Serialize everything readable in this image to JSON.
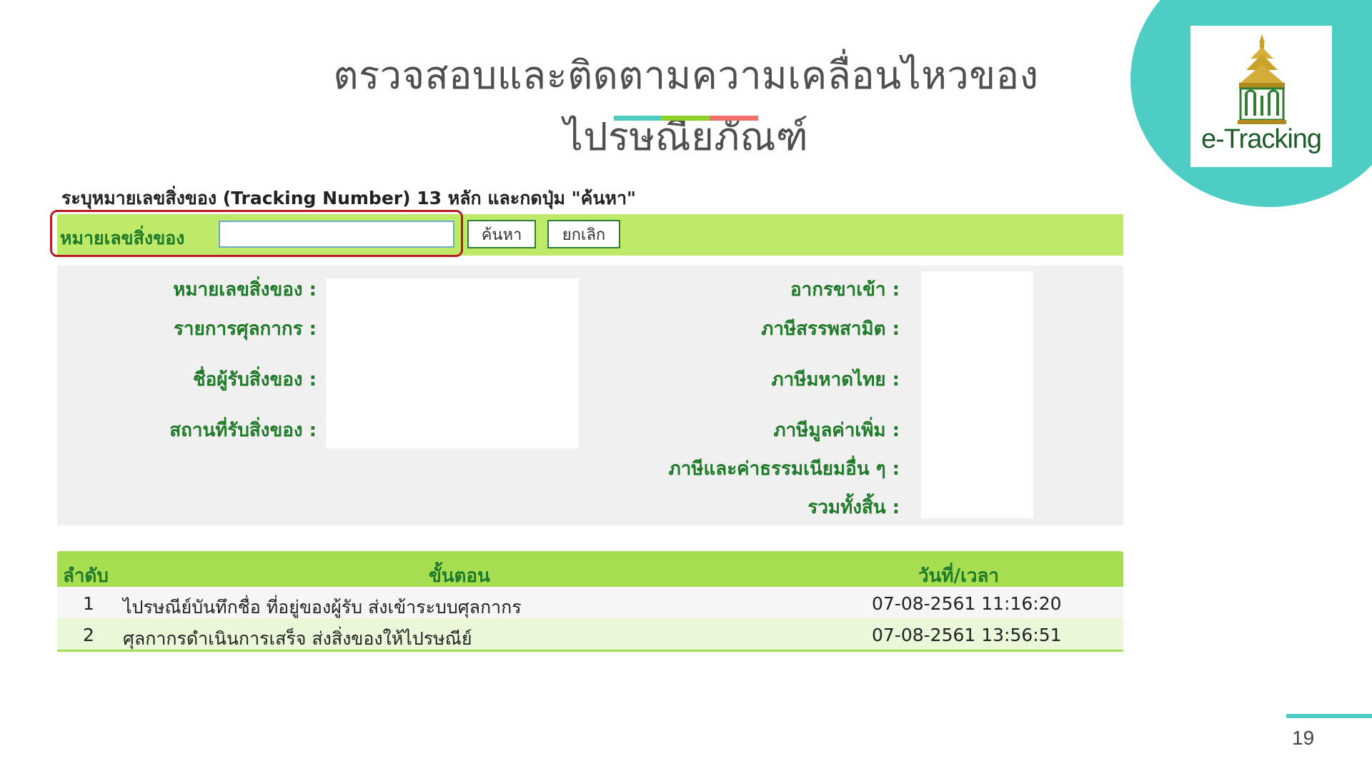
{
  "header": {
    "title": "ตรวจสอบและติดตามความเคลื่อนไหวของไปรษณียภัณฑ์",
    "logo_text": "e-Tracking"
  },
  "search": {
    "instruction": "ระบุหมายเลขสิ่งของ (Tracking Number) 13 หลัก และกดปุ่ม \"ค้นหา\"",
    "label": "หมายเลขสิ่งของ",
    "input_value": "",
    "search_button": "ค้นหา",
    "cancel_button": "ยกเลิก"
  },
  "details": {
    "left_labels": [
      "หมายเลขสิ่งของ :",
      "รายการศุลกากร :",
      "ชื่อผู้รับสิ่งของ :",
      "สถานที่รับสิ่งของ :"
    ],
    "right_labels": [
      "อากรขาเข้า :",
      "ภาษีสรรพสามิต :",
      "ภาษีมหาดไทย :",
      "ภาษีมูลค่าเพิ่ม :",
      "ภาษีและค่าธรรมเนียมอื่น ๆ :",
      "รวมทั้งสิ้น :"
    ]
  },
  "timeline": {
    "headers": {
      "seq": "ลำดับ",
      "step": "ขั้นตอน",
      "datetime": "วันที่/เวลา"
    },
    "rows": [
      {
        "seq": "1",
        "step": "ไปรษณีย์บันทึกชื่อ ที่อยู่ของผู้รับ ส่งเข้าระบบศุลกากร",
        "datetime": "07-08-2561 11:16:20"
      },
      {
        "seq": "2",
        "step": "ศุลกากรดำเนินการเสร็จ ส่งสิ่งของให้ไปรษณีย์",
        "datetime": "07-08-2561 13:56:51"
      }
    ]
  },
  "footer": {
    "page_number": "19"
  },
  "colors": {
    "accent_teal": "#4ecdc4",
    "accent_green": "#8fd129",
    "accent_coral": "#f0706c",
    "form_green": "#bfea69",
    "label_green": "#1f7a2a",
    "highlight_red": "#b81d24"
  }
}
